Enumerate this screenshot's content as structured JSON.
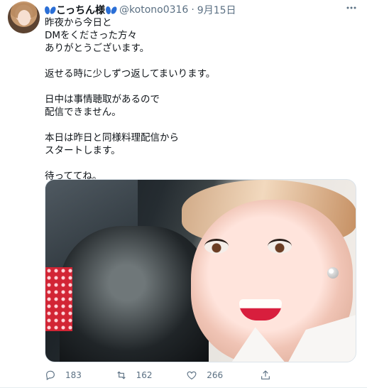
{
  "tweet": {
    "user": {
      "display_name": "こっちん様",
      "handle": "@kotono0316",
      "separator": "·",
      "date": "9月15日"
    },
    "paragraphs": [
      "昨夜から今日と\nDMをくださった方々\nありがとうございます。",
      "返せる時に少しずつ返してまいります。",
      "日中は事情聴取があるので\n配信できません。",
      "本日は昨日と同様料理配信から\nスタートします。",
      "待っててね。"
    ],
    "actions": {
      "reply": {
        "count": "183",
        "icon": "reply-icon"
      },
      "retweet": {
        "count": "162",
        "icon": "retweet-icon"
      },
      "like": {
        "count": "266",
        "icon": "heart-icon"
      },
      "share": {
        "icon": "share-icon"
      }
    }
  },
  "colors": {
    "text": "#0f1419",
    "secondary": "#5b7083",
    "butterfly": "#2b6fd6",
    "border": "#e6ecf0"
  }
}
